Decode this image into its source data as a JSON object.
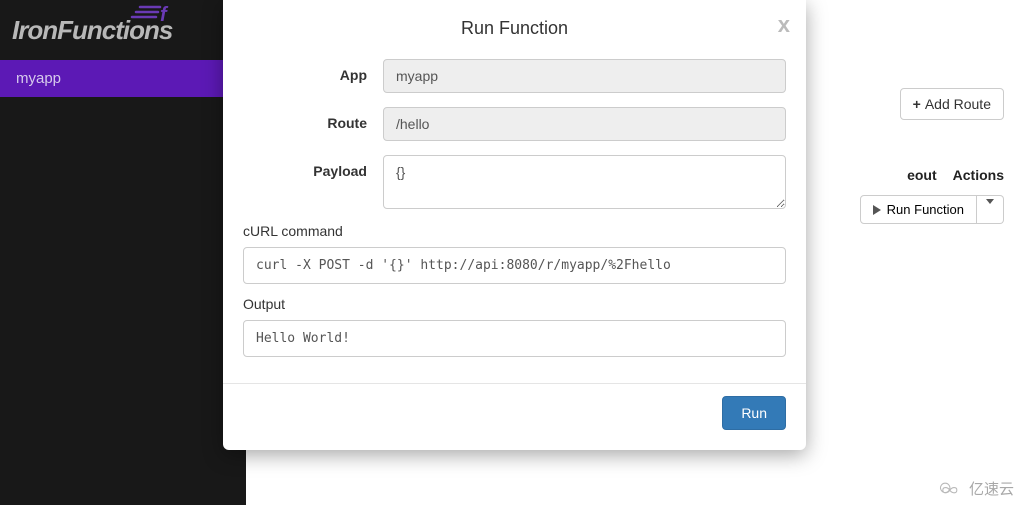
{
  "brand": {
    "name": "IronFunctions"
  },
  "sidebar": {
    "items": [
      {
        "label": "myapp"
      }
    ]
  },
  "toolbar": {
    "add_route_label": "Add Route"
  },
  "table": {
    "header_timeout": "eout",
    "header_actions": "Actions",
    "row_action_label": "Run Function"
  },
  "modal": {
    "title": "Run Function",
    "close_glyph": "x",
    "labels": {
      "app": "App",
      "route": "Route",
      "payload": "Payload",
      "curl": "cURL command",
      "output": "Output"
    },
    "fields": {
      "app": "myapp",
      "route": "/hello",
      "payload": "{}"
    },
    "curl_command": "curl -X POST -d '{}' http://api:8080/r/myapp/%2Fhello",
    "output": "Hello World!",
    "run_button": "Run"
  },
  "watermark": {
    "text": "亿速云"
  }
}
